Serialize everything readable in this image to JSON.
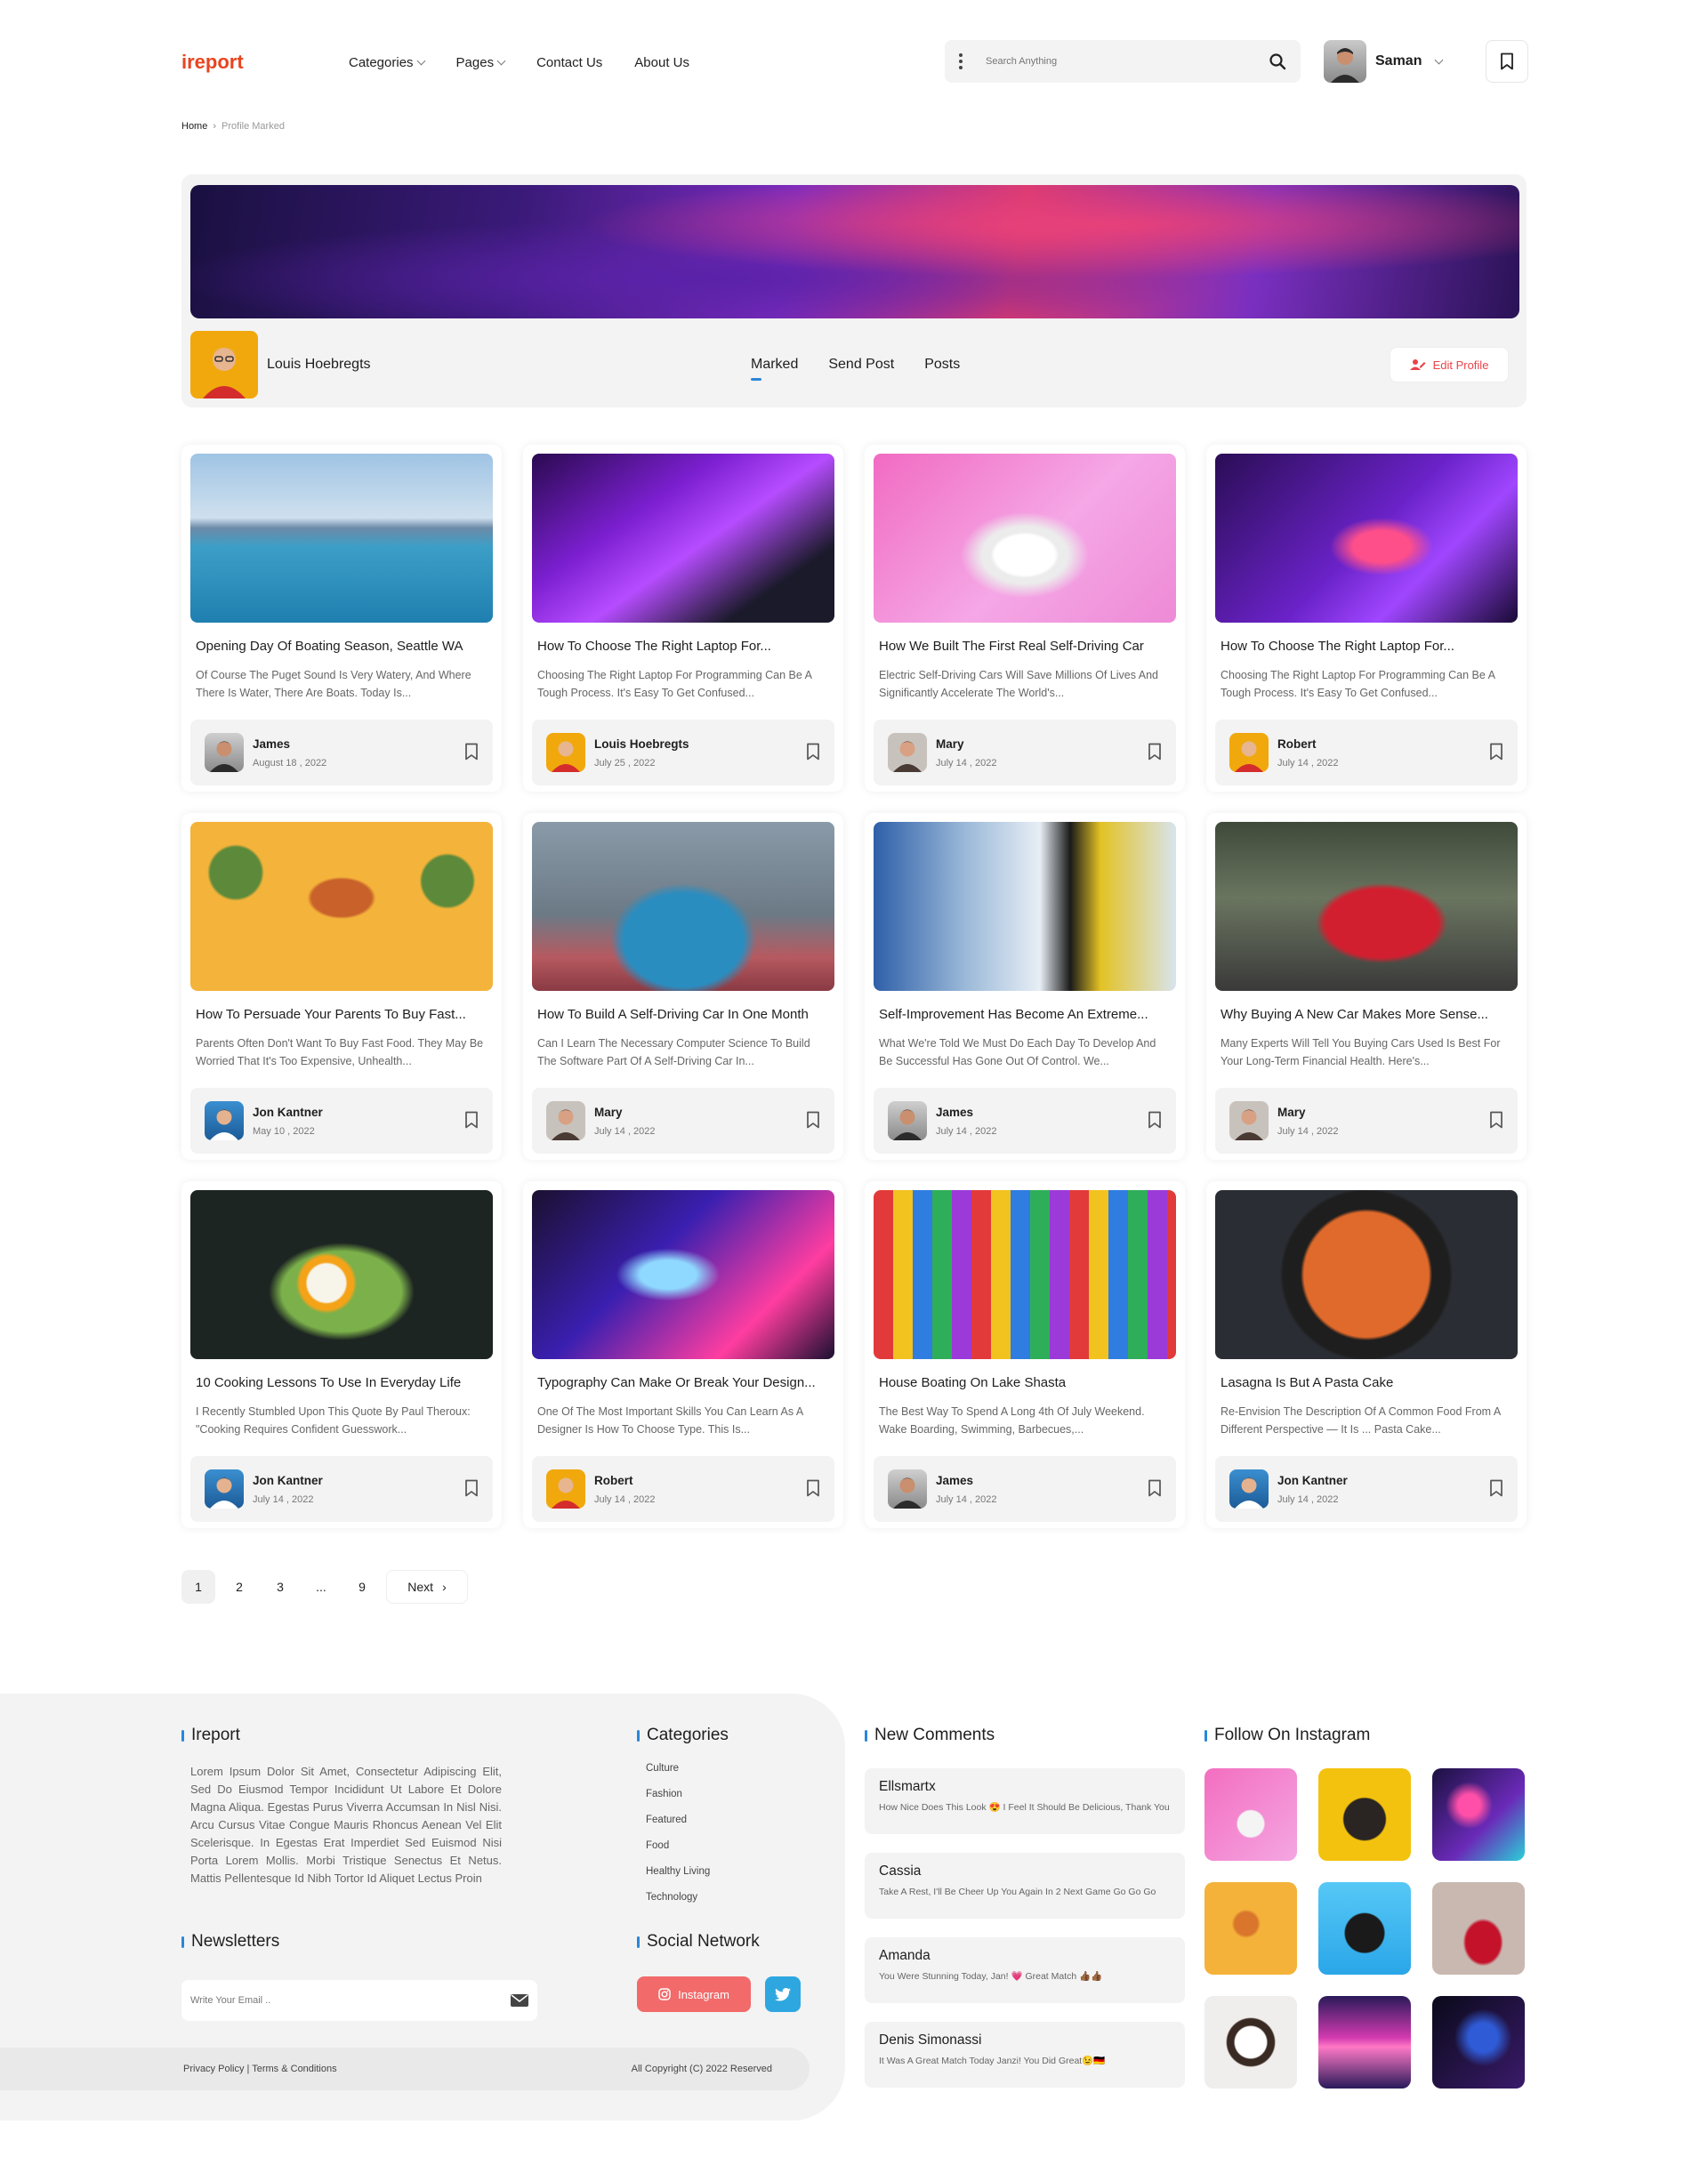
{
  "header": {
    "logo": "ireport",
    "nav": [
      "Categories",
      "Pages",
      "Contact Us",
      "About Us"
    ],
    "search_placeholder": "Search Anything",
    "user_name": "Saman"
  },
  "breadcrumb": {
    "home": "Home",
    "current": "Profile Marked"
  },
  "profile": {
    "name": "Louis Hoebregts",
    "tabs": [
      "Marked",
      "Send Post",
      "Posts"
    ],
    "active_tab": "Marked",
    "edit_label": "Edit Profile"
  },
  "posts": [
    {
      "title": "Opening Day Of Boating Season, Seattle WA",
      "desc": "Of Course The Puget Sound Is Very Watery, And Where There Is Water, There Are Boats. Today Is...",
      "author": "James",
      "date": "August 18 , 2022"
    },
    {
      "title": "How To Choose The Right Laptop For...",
      "desc": "Choosing The Right Laptop For Programming Can Be A Tough Process. It's Easy To Get Confused...",
      "author": "Louis Hoebregts",
      "date": "July 25 , 2022"
    },
    {
      "title": "How We Built The First Real Self-Driving Car",
      "desc": "Electric Self-Driving Cars Will Save Millions Of Lives And Significantly Accelerate The World's...",
      "author": "Mary",
      "date": "July 14 , 2022"
    },
    {
      "title": "How To Choose The Right Laptop For...",
      "desc": "Choosing The Right Laptop For Programming Can Be A Tough Process. It's Easy To Get Confused...",
      "author": "Robert",
      "date": "July 14 , 2022"
    },
    {
      "title": "How To Persuade Your Parents To Buy Fast...",
      "desc": "Parents Often Don't Want To Buy Fast Food. They May Be Worried That It's Too Expensive, Unhealth...",
      "author": "Jon Kantner",
      "date": "May 10 , 2022"
    },
    {
      "title": "How To Build A Self-Driving Car In One Month",
      "desc": "Can I Learn The Necessary Computer Science To Build The Software Part Of A Self-Driving Car In...",
      "author": "Mary",
      "date": "July 14 , 2022"
    },
    {
      "title": "Self-Improvement Has Become An Extreme...",
      "desc": "What We're Told We Must Do Each Day To Develop And Be Successful Has Gone Out Of Control. We...",
      "author": "James",
      "date": "July 14 , 2022"
    },
    {
      "title": "Why Buying A New Car Makes More Sense...",
      "desc": "Many Experts Will Tell You Buying Cars Used Is Best For Your Long-Term Financial Health. Here's...",
      "author": "Mary",
      "date": "July 14 , 2022"
    },
    {
      "title": "10 Cooking Lessons To Use In Everyday Life",
      "desc": "I Recently Stumbled Upon This Quote By Paul Theroux: \"Cooking Requires Confident Guesswork...",
      "author": "Jon Kantner",
      "date": "July 14 , 2022"
    },
    {
      "title": "Typography Can Make Or Break Your Design...",
      "desc": "One Of The Most Important Skills You Can Learn As A Designer Is How To Choose Type. This Is...",
      "author": "Robert",
      "date": "July 14 , 2022"
    },
    {
      "title": "House Boating On Lake Shasta",
      "desc": "The Best Way To Spend A Long 4th Of July Weekend. Wake Boarding, Swimming, Barbecues,...",
      "author": "James",
      "date": "July 14 , 2022"
    },
    {
      "title": "Lasagna Is But A Pasta Cake",
      "desc": "Re-Envision The Description Of A Common Food From A Different Perspective — It Is ... Pasta Cake...",
      "author": "Jon Kantner",
      "date": "July 14 , 2022"
    }
  ],
  "pagination": {
    "pages": [
      "1",
      "2",
      "3",
      "...",
      "9"
    ],
    "next": "Next"
  },
  "footer": {
    "about_title": "Ireport",
    "about_text": "Lorem Ipsum Dolor Sit Amet, Consectetur Adipiscing Elit, Sed Do Eiusmod Tempor Incididunt Ut Labore Et Dolore Magna Aliqua. Egestas Purus Viverra Accumsan In Nisl Nisi. Arcu Cursus Vitae Congue Mauris Rhoncus Aenean Vel Elit Scelerisque. In Egestas Erat Imperdiet Sed Euismod Nisi Porta Lorem Mollis. Morbi Tristique Senectus Et Netus. Mattis Pellentesque Id Nibh Tortor Id Aliquet Lectus Proin",
    "categories_title": "Categories",
    "categories": [
      "Culture",
      "Fashion",
      "Featured",
      "Food",
      "Healthy Living",
      "Technology"
    ],
    "newsletter_title": "Newsletters",
    "newsletter_placeholder": "Write Your Email ..",
    "social_title": "Social Network",
    "instagram_label": "Instagram",
    "comments_title": "New Comments",
    "comments": [
      {
        "name": "Ellsmartx",
        "text": "How Nice Does This Look 😍 I Feel It Should Be Delicious, Thank You"
      },
      {
        "name": "Cassia",
        "text": "Take A Rest, I'll Be Cheer Up You Again In 2 Next Game Go Go Go"
      },
      {
        "name": "Amanda",
        "text": "You Were Stunning Today, Jan! 💗 Great Match 👍🏾👍🏾"
      },
      {
        "name": "Denis Simonassi",
        "text": "It Was A Great Match Today Janzi! You Did Great😉🇩🇪"
      }
    ],
    "instagram_title": "Follow On Instagram",
    "policy": "Privacy Policy | Terms & Conditions",
    "copyright": "All Copyright (C) 2022 Reserved"
  }
}
